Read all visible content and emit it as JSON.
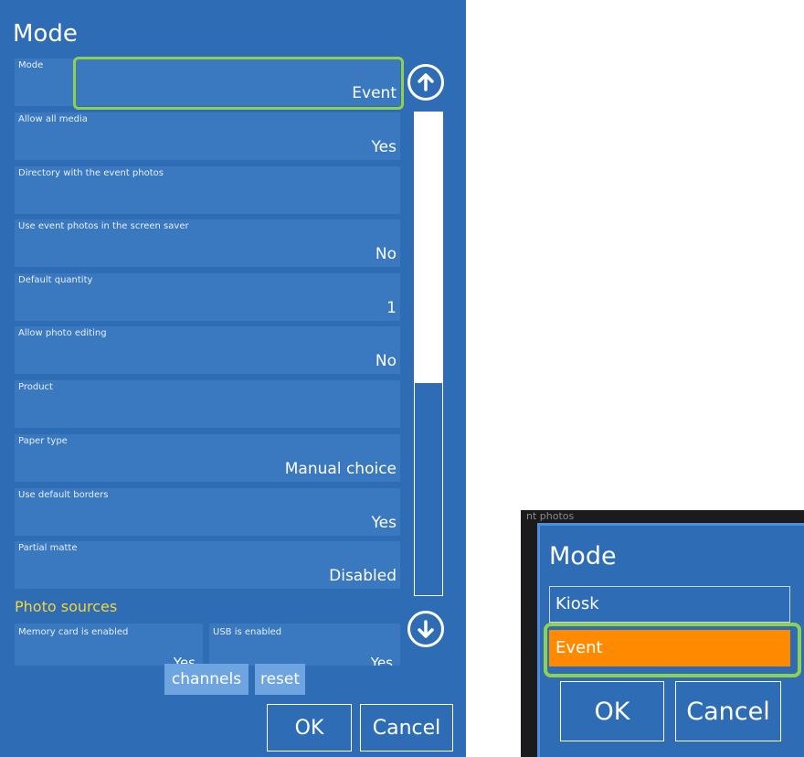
{
  "main": {
    "title": "Mode",
    "settings": [
      {
        "label": "Mode",
        "value": "Event"
      },
      {
        "label": "Allow all media",
        "value": "Yes"
      },
      {
        "label": "Directory with the event photos",
        "value": ""
      },
      {
        "label": "Use event photos in the screen saver",
        "value": "No"
      },
      {
        "label": "Default quantity",
        "value": "1"
      },
      {
        "label": "Allow photo editing",
        "value": "No"
      },
      {
        "label": "Product",
        "value": ""
      },
      {
        "label": "Paper type",
        "value": "Manual choice"
      },
      {
        "label": "Use default borders",
        "value": "Yes"
      },
      {
        "label": "Partial matte",
        "value": "Disabled"
      }
    ],
    "section_label": "Photo sources",
    "sources": [
      {
        "label": "Memory card is enabled",
        "value": "Yes"
      },
      {
        "label": "USB is enabled",
        "value": "Yes"
      }
    ],
    "channels_label": "channels",
    "reset_label": "reset",
    "ok_label": "OK",
    "cancel_label": "Cancel",
    "scroll_up_icon": "arrow-up-circle-icon",
    "scroll_down_icon": "arrow-down-circle-icon",
    "scroll_position": 0.56
  },
  "popup": {
    "ghost_text": "nt photos",
    "title": "Mode",
    "options": [
      {
        "label": "Kiosk",
        "selected": false
      },
      {
        "label": "Event",
        "selected": true
      }
    ],
    "ok_label": "OK",
    "cancel_label": "Cancel"
  },
  "colors": {
    "panel_bg": "#2e6db5",
    "row_bg": "#3a78bf",
    "highlight_ring": "#8fd14f",
    "selected_option": "#ff8a00",
    "section_text": "#f5d53a"
  }
}
